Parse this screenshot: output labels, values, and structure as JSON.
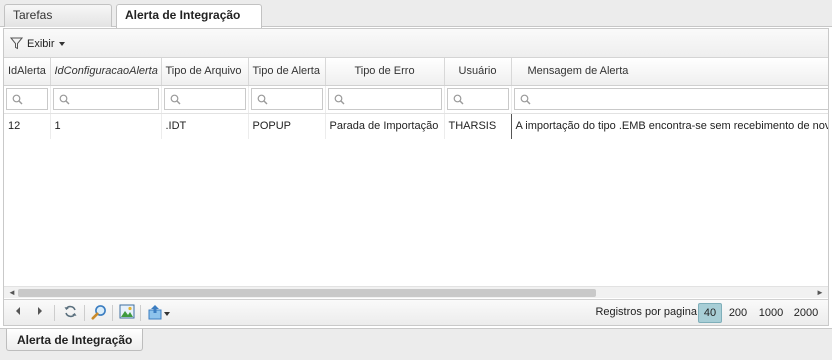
{
  "tabs": [
    {
      "label": "Tarefas Principais"
    },
    {
      "label": "Alerta de Integração"
    }
  ],
  "tab_close_glyph": "×",
  "toolbar": {
    "exibir_label": "Exibir",
    "icon": "filter-icon"
  },
  "grid": {
    "columns": [
      {
        "label": "IdAlerta"
      },
      {
        "label": "IdConfiguracaoAlerta"
      },
      {
        "label": "Tipo de Arquivo"
      },
      {
        "label": "Tipo de Alerta"
      },
      {
        "label": "Tipo de Erro"
      },
      {
        "label": "Usuário"
      },
      {
        "label": "Mensagem de Alerta"
      }
    ],
    "rows": [
      {
        "IdAlerta": "12",
        "IdConfiguracaoAlerta": "1",
        "TipoArquivo": ".IDT",
        "TipoAlerta": "POPUP",
        "TipoErro": "Parada de Importação",
        "Usuario": "THARSIS",
        "Mensagem": "A importação do tipo .EMB encontra-se sem recebimento de nov"
      }
    ]
  },
  "pager": {
    "records_per_page_label": "Registros por pagina:",
    "page_sizes": [
      "40",
      "200",
      "1000",
      "2000"
    ],
    "selected_page_size": "40"
  },
  "bottom_tab": {
    "label": "Alerta de Integração"
  },
  "colors": {
    "accent": "#a8ced6",
    "border": "#c9c9c9"
  }
}
